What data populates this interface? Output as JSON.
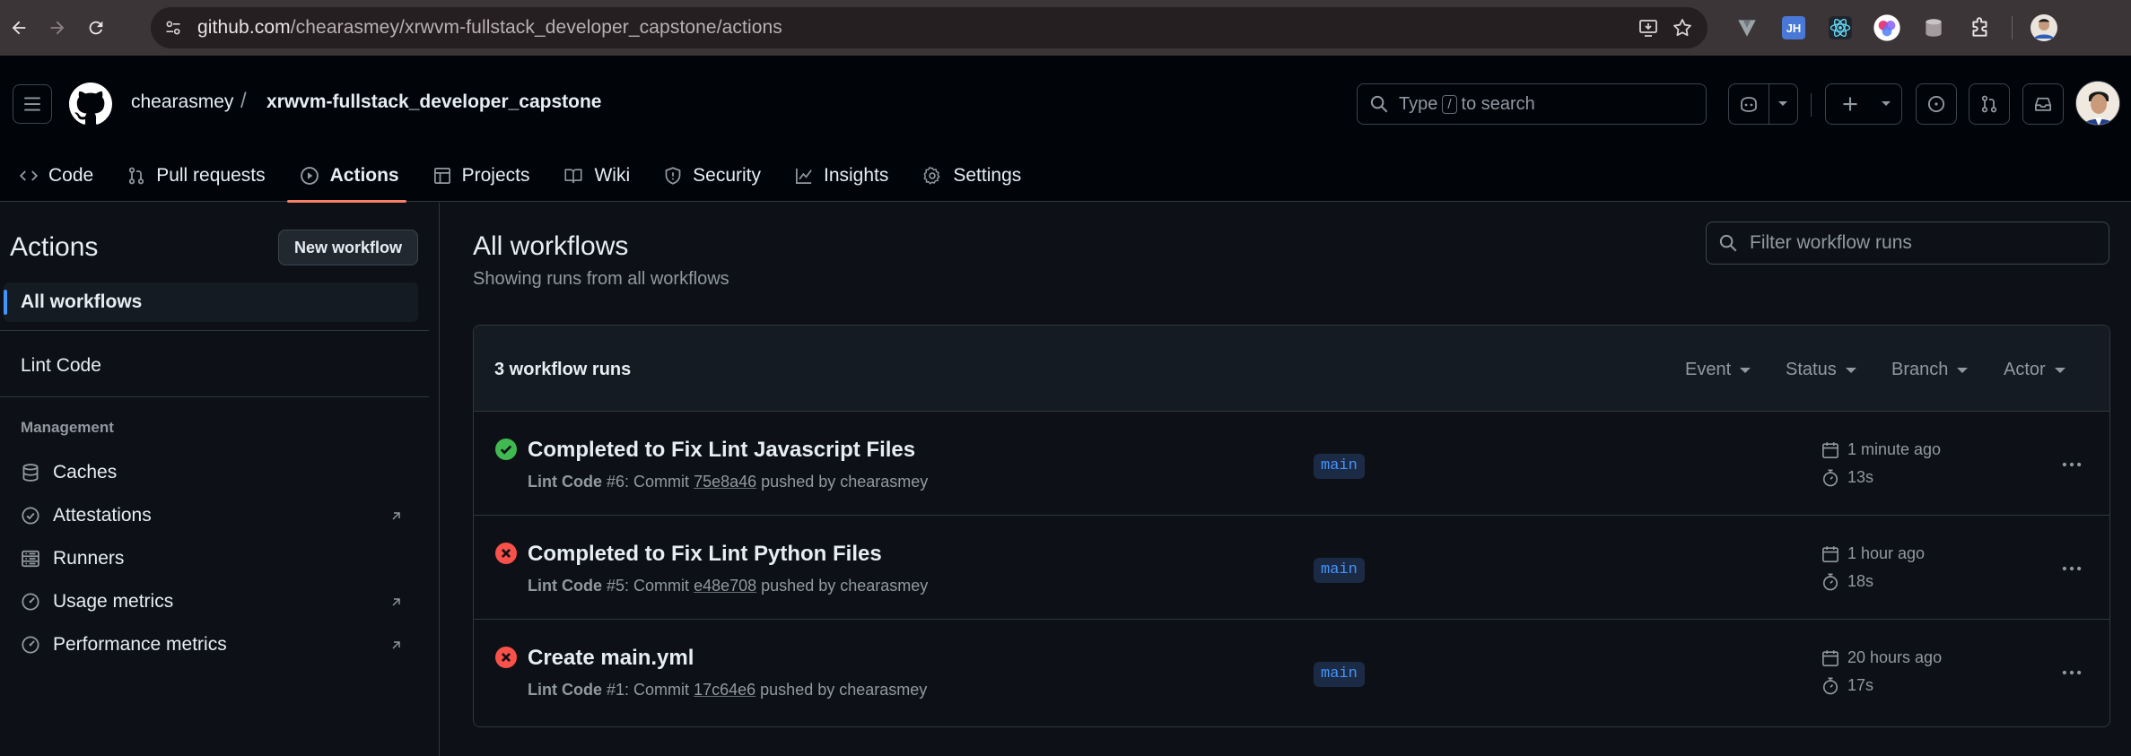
{
  "browser": {
    "url_host": "github.com",
    "url_path": "/chearasmey/xrwvm-fullstack_developer_capstone/actions",
    "extensions": [
      "vee-icon",
      "jetbrains-icon",
      "react-devtools-icon",
      "colorful-extension-icon",
      "database-icon",
      "puzzle-icon"
    ],
    "ext_jh_label": "JH"
  },
  "header": {
    "owner": "chearasmey",
    "separator": "/",
    "repo": "xrwvm-fullstack_developer_capstone",
    "search_prefix": "Type",
    "search_key": "/",
    "search_suffix": "to search"
  },
  "tabs": [
    {
      "label": "Code",
      "icon": "code-icon"
    },
    {
      "label": "Pull requests",
      "icon": "pull-request-icon"
    },
    {
      "label": "Actions",
      "icon": "play-icon",
      "active": true
    },
    {
      "label": "Projects",
      "icon": "table-icon"
    },
    {
      "label": "Wiki",
      "icon": "book-icon"
    },
    {
      "label": "Security",
      "icon": "shield-icon"
    },
    {
      "label": "Insights",
      "icon": "graph-icon"
    },
    {
      "label": "Settings",
      "icon": "gear-icon"
    }
  ],
  "sidebar": {
    "title": "Actions",
    "new_workflow": "New workflow",
    "all_workflows": "All workflows",
    "workflows": [
      "Lint Code"
    ],
    "management_heading": "Management",
    "management": [
      {
        "label": "Caches",
        "icon": "database-icon",
        "external": false
      },
      {
        "label": "Attestations",
        "icon": "verified-icon",
        "external": true
      },
      {
        "label": "Runners",
        "icon": "server-icon",
        "external": false
      },
      {
        "label": "Usage metrics",
        "icon": "meter-icon",
        "external": true
      },
      {
        "label": "Performance metrics",
        "icon": "meter-icon",
        "external": true
      }
    ]
  },
  "main": {
    "title": "All workflows",
    "subtitle": "Showing runs from all workflows",
    "filter_placeholder": "Filter workflow runs",
    "runs_count": "3 workflow runs",
    "filters": [
      "Event",
      "Status",
      "Branch",
      "Actor"
    ],
    "runs": [
      {
        "status": "success",
        "title": "Completed to Fix Lint Javascript Files",
        "workflow": "Lint Code",
        "run_number": "#6",
        "commit_text": ": Commit",
        "sha": "75e8a46",
        "pushed_by": "pushed by chearasmey",
        "branch": "main",
        "when": "1 minute ago",
        "duration": "13s"
      },
      {
        "status": "failure",
        "title": "Completed to Fix Lint Python Files",
        "workflow": "Lint Code",
        "run_number": "#5",
        "commit_text": ": Commit",
        "sha": "e48e708",
        "pushed_by": "pushed by chearasmey",
        "branch": "main",
        "when": "1 hour ago",
        "duration": "18s"
      },
      {
        "status": "failure",
        "title": "Create main.yml",
        "workflow": "Lint Code",
        "run_number": "#1",
        "commit_text": ": Commit",
        "sha": "17c64e6",
        "pushed_by": "pushed by chearasmey",
        "branch": "main",
        "when": "20 hours ago",
        "duration": "17s"
      }
    ]
  },
  "colors": {
    "accent_tab": "#f78166",
    "success": "#3fb950",
    "failure": "#f85149",
    "link": "#4493f8"
  }
}
